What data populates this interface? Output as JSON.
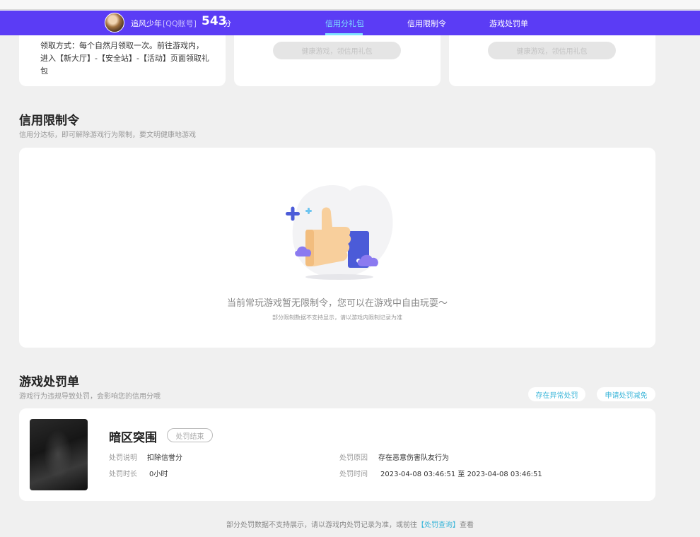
{
  "header": {
    "username": "追风少年",
    "account_type": "[QQ账号]",
    "score": "543",
    "score_unit": "分",
    "tabs": [
      {
        "label": "信用分礼包",
        "active": true
      },
      {
        "label": "信用限制令",
        "active": false
      },
      {
        "label": "游戏处罚单",
        "active": false
      }
    ]
  },
  "gift_cards": {
    "claim_desc": "领取方式：每个自然月领取一次。前往游戏内，进入【新大厅】-【安全站】-【活动】页面领取礼包",
    "card2_button": "健康游戏，领信用礼包",
    "card3_button": "健康游戏，领信用礼包"
  },
  "restriction": {
    "title": "信用限制令",
    "subtitle": "信用分达标，即可解除游戏行为限制，要文明健康地游戏",
    "empty_main": "当前常玩游戏暂无限制令，您可以在游戏中自由玩耍～",
    "empty_sub": "部分限制数据不支持显示，请以游戏内限制记录为准"
  },
  "penalty": {
    "title": "游戏处罚单",
    "subtitle": "游戏行为违规导致处罚，会影响您的信用分哦",
    "btn_appeal": "存在异常处罚",
    "btn_reduce": "申请处罚减免",
    "item": {
      "game": "暗区突围",
      "status": "处罚结束",
      "desc_label": "处罚说明",
      "desc_value": "扣除信誉分",
      "duration_label": "处罚时长",
      "duration_value": "0小时",
      "reason_label": "处罚原因",
      "reason_value": "存在恶意伤害队友行为",
      "time_label": "处罚时间",
      "time_value": "2023-04-08 03:46:51 至 2023-04-08 03:46:51"
    }
  },
  "footer": {
    "prefix": "部分处罚数据不支持展示，请以游戏内处罚记录为准，或前往",
    "link": "【处罚查询】",
    "suffix": "查看"
  },
  "colors": {
    "nav_bg": "#5b3cf5",
    "accent": "#3bb6d9",
    "active_tab": "#7fe3ff"
  }
}
